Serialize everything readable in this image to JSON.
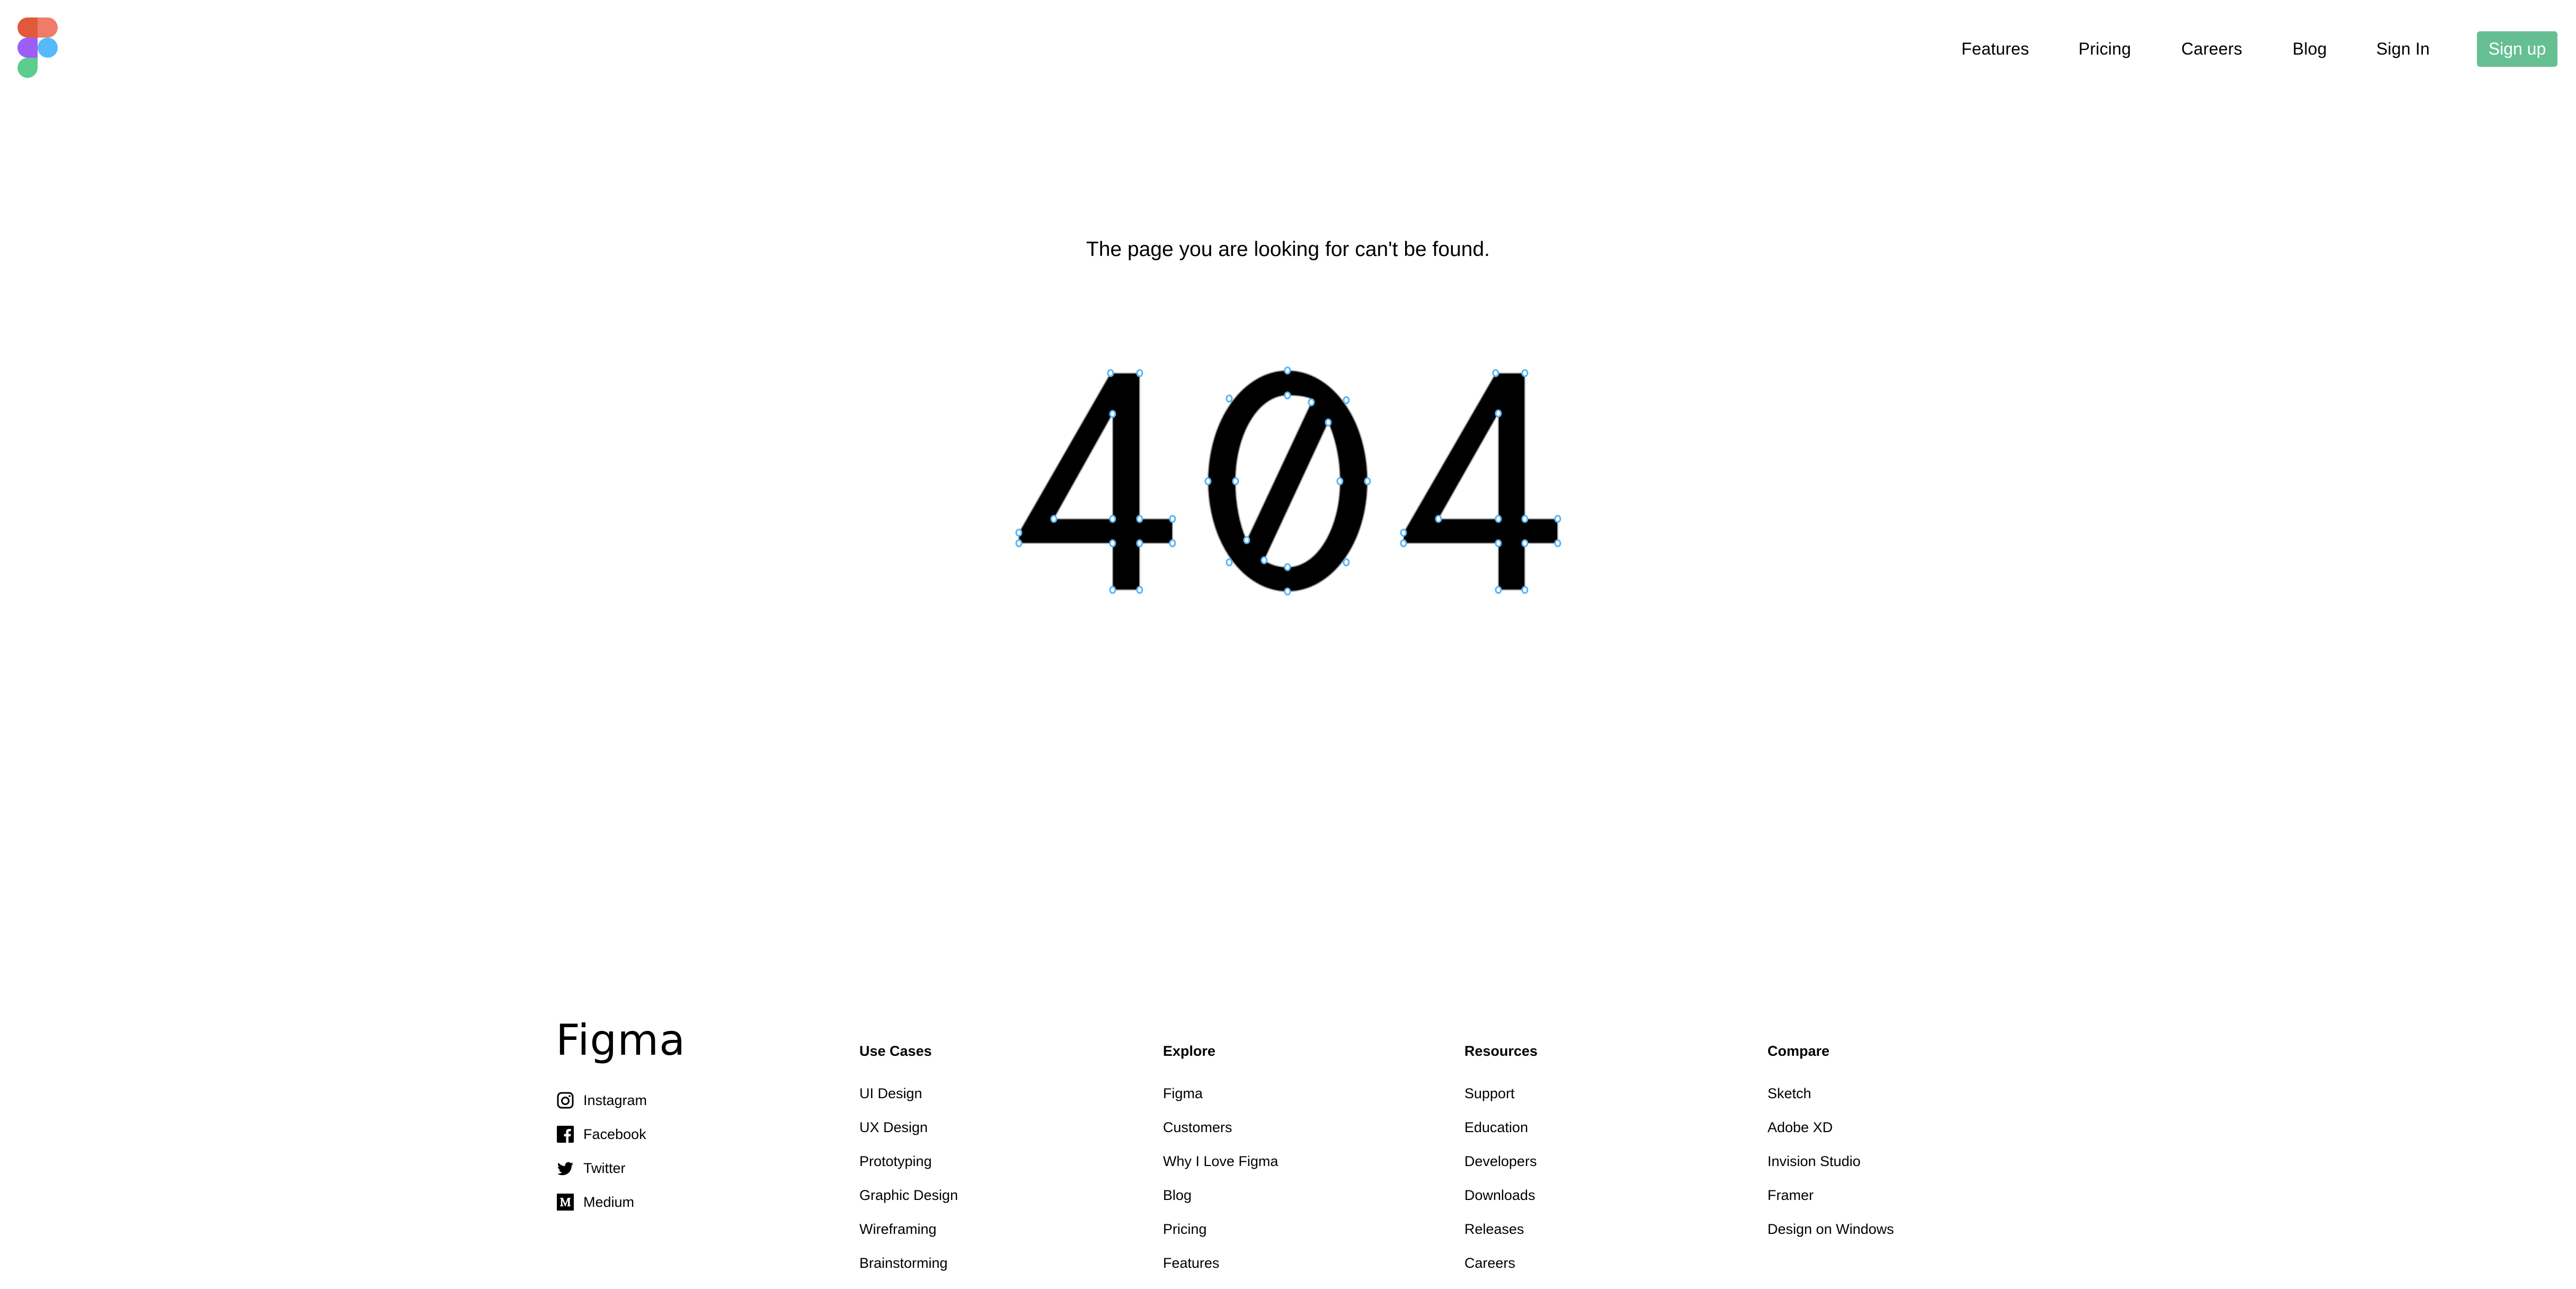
{
  "brand": {
    "logo_icon": "figma-logo-icon",
    "logo_colors": [
      "#e0593a",
      "#ef7b6a",
      "#9b5ff7",
      "#55b9fa",
      "#5ccd8f"
    ],
    "accent": "#66bf93"
  },
  "nav": {
    "links": [
      "Features",
      "Pricing",
      "Careers",
      "Blog",
      "Sign In"
    ],
    "signup_label": "Sign up"
  },
  "main": {
    "message": "The page you are looking for can't be found.",
    "code": "404",
    "control_point_color": "#5bb4f5"
  },
  "footer": {
    "wordmark": "Figma",
    "social": [
      {
        "icon": "instagram-icon",
        "label": "Instagram"
      },
      {
        "icon": "facebook-icon",
        "label": "Facebook"
      },
      {
        "icon": "twitter-icon",
        "label": "Twitter"
      },
      {
        "icon": "medium-icon",
        "label": "Medium"
      }
    ],
    "columns": [
      {
        "heading": "Use Cases",
        "items": [
          "UI Design",
          "UX Design",
          "Prototyping",
          "Graphic Design",
          "Wireframing",
          "Brainstorming"
        ]
      },
      {
        "heading": "Explore",
        "items": [
          "Figma",
          "Customers",
          "Why I Love Figma",
          "Blog",
          "Pricing",
          "Features"
        ]
      },
      {
        "heading": "Resources",
        "items": [
          "Support",
          "Education",
          "Developers",
          "Downloads",
          "Releases",
          "Careers"
        ]
      },
      {
        "heading": "Compare",
        "items": [
          "Sketch",
          "Adobe XD",
          "Invision Studio",
          "Framer",
          "Design on Windows"
        ]
      }
    ]
  }
}
